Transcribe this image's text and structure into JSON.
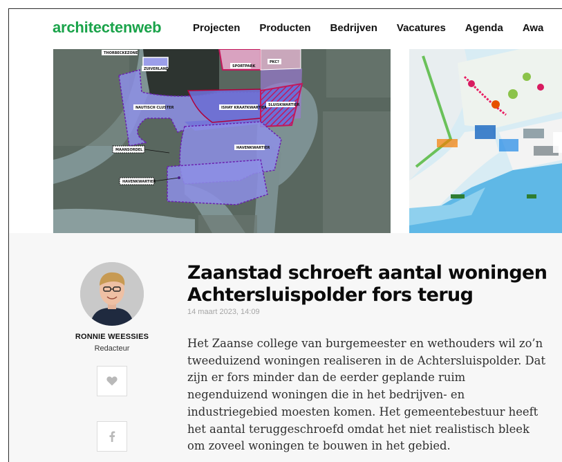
{
  "header": {
    "logo": "architectenweb",
    "nav": [
      "Projecten",
      "Producten",
      "Bedrijven",
      "Vacatures",
      "Agenda",
      "Awa"
    ]
  },
  "map": {
    "labels": [
      "THORBECKEZONE",
      "ZUIVERLAND",
      "SPORTPARK",
      "PKC?",
      "NAUTISCH CLUSTER",
      "ISHAY KRAATKWARTIER",
      "SLUISKWARTIER",
      "MAANSORDEL",
      "HAVENKWARTIER",
      "HAVENKWARTIER"
    ]
  },
  "author": {
    "name": "RONNIE WEESSIES",
    "role": "Redacteur"
  },
  "article": {
    "title": "Zaanstad schroeft aantal woningen Achtersluispolder fors terug",
    "date": "14 maart 2023, 14:09",
    "body": "Het Zaanse college van burgemeester en wethouders wil zo’n tweeduizend woningen realiseren in de Achtersluispolder. Dat zijn er fors minder dan de eerder geplande ruim negenduizend woningen die in het bedrijven- en industriegebied moesten komen. Het gemeentebestuur heeft het aantal teruggeschroefd omdat het niet realistisch bleek om zoveel woningen te bouwen in het gebied."
  },
  "icons": {
    "like": "heart-icon",
    "facebook": "facebook-icon"
  },
  "colors": {
    "brand": "#1aa34a",
    "zone": "#7b7fe0",
    "highlight": "#c2185b"
  }
}
